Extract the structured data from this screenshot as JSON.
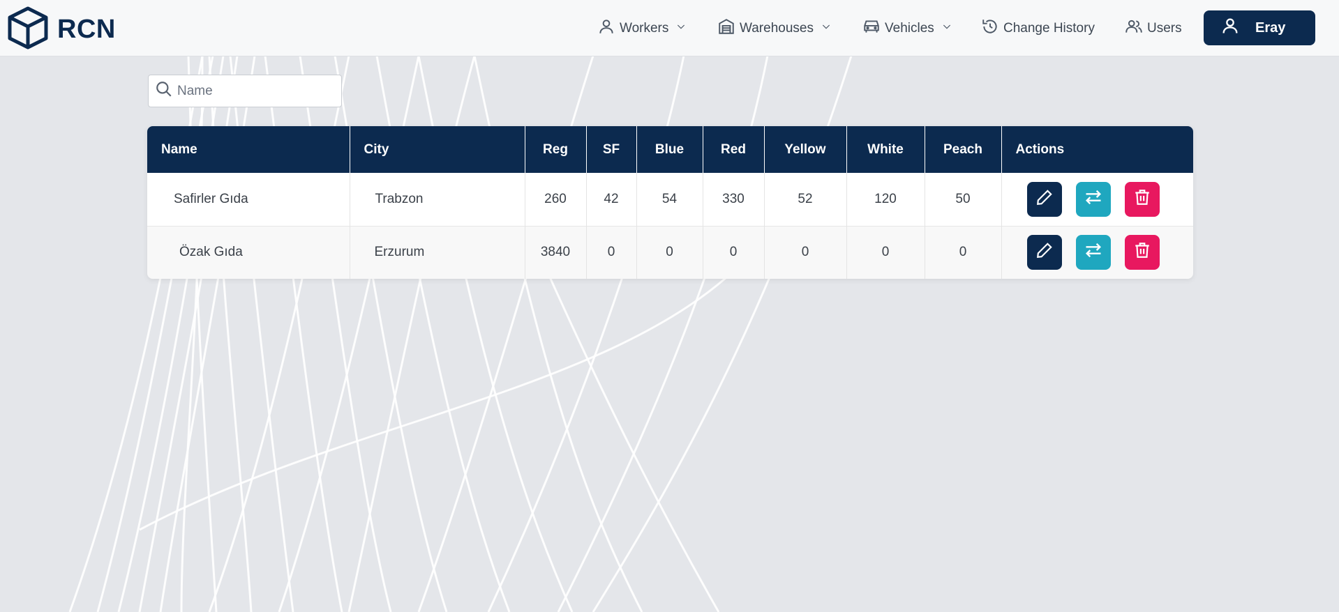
{
  "app": {
    "logo_text": "RCN"
  },
  "nav": {
    "workers": "Workers",
    "warehouses": "Warehouses",
    "vehicles": "Vehicles",
    "change_history": "Change History",
    "users": "Users",
    "user_name": "Eray"
  },
  "search": {
    "placeholder": "Name",
    "value": ""
  },
  "table": {
    "headers": [
      "Name",
      "City",
      "Reg",
      "SF",
      "Blue",
      "Red",
      "Yellow",
      "White",
      "Peach",
      "Actions"
    ],
    "rows": [
      {
        "name": "Safirler Gıda",
        "city": "Trabzon",
        "reg": "260",
        "sf": "42",
        "blue": "54",
        "red": "330",
        "yellow": "52",
        "white": "120",
        "peach": "50"
      },
      {
        "name": "Özak Gıda",
        "city": "Erzurum",
        "reg": "3840",
        "sf": "0",
        "blue": "0",
        "red": "0",
        "yellow": "0",
        "white": "0",
        "peach": "0"
      }
    ]
  },
  "icons": {
    "logo": "cube-icon",
    "workers": "person-icon",
    "warehouses": "warehouse-icon",
    "vehicles": "car-icon",
    "change_history": "history-icon",
    "users": "users-icon",
    "user": "person-icon",
    "search": "search-icon",
    "edit": "pencil-icon",
    "transfer": "arrows-transfer-icon",
    "delete": "trash-icon"
  },
  "colors": {
    "primary": "#0c2a4f",
    "transfer": "#1fa7bf",
    "delete": "#e8185f",
    "background": "#e4e6ea"
  }
}
